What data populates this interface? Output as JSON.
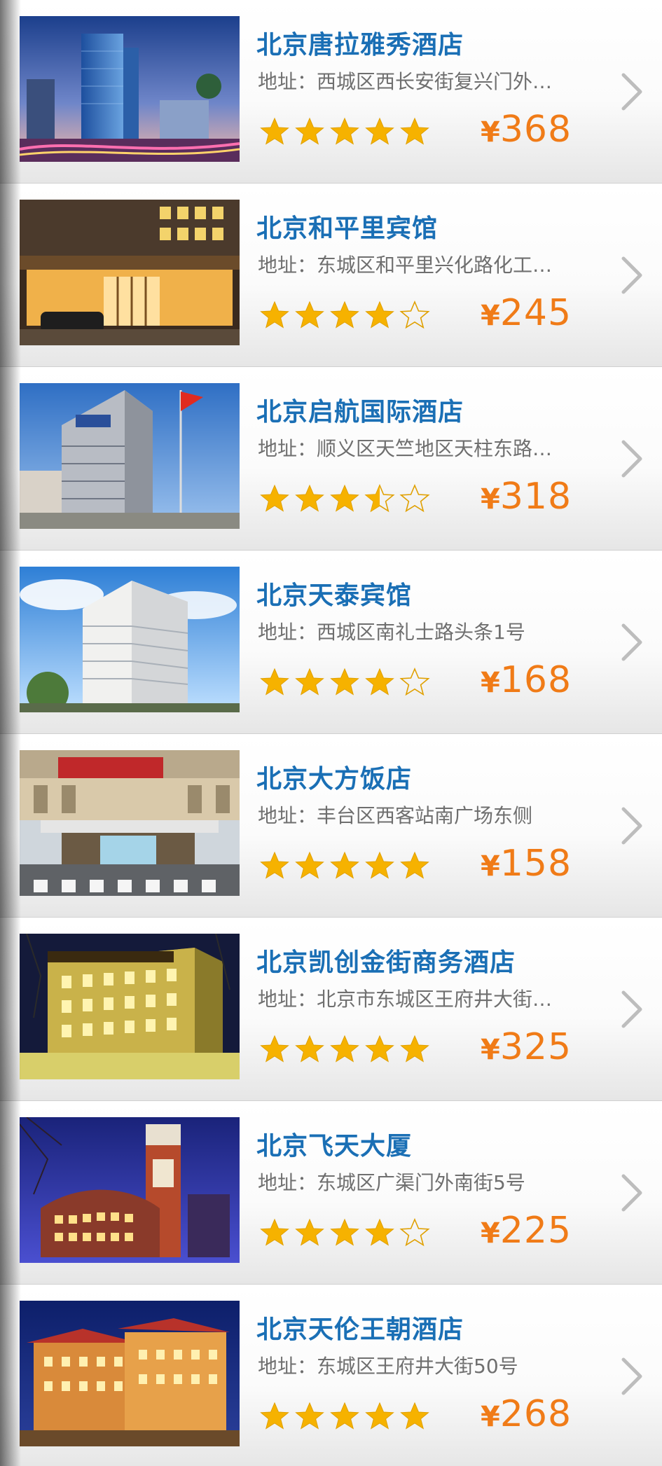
{
  "colors": {
    "hotel_name": "#1a6fb5",
    "address": "#6f6f6f",
    "price": "#f07b17",
    "star_fill": "#f6b200",
    "star_outline": "#e0a000"
  },
  "icons": {
    "chevron": "chevron-right-icon",
    "star_full": "star-full-icon",
    "star_half": "star-half-icon",
    "star_empty": "star-empty-icon"
  },
  "hotels": [
    {
      "name": "北京唐拉雅秀酒店",
      "address": "地址：西城区西长安街复兴门外…",
      "rating": 5,
      "currency": "¥",
      "price": "368",
      "photo": "photo-glass-tower-night"
    },
    {
      "name": "北京和平里宾馆",
      "address": "地址：东城区和平里兴化路化工…",
      "rating": 4,
      "currency": "¥",
      "price": "245",
      "photo": "photo-lit-entrance-evening"
    },
    {
      "name": "北京启航国际酒店",
      "address": "地址：顺义区天竺地区天柱东路…",
      "rating": 3.5,
      "currency": "¥",
      "price": "318",
      "photo": "photo-grey-building-flag"
    },
    {
      "name": "北京天泰宾馆",
      "address": "地址：西城区南礼士路头条1号",
      "rating": 4,
      "currency": "¥",
      "price": "168",
      "photo": "photo-white-tower-sky"
    },
    {
      "name": "北京大方饭店",
      "address": "地址：丰台区西客站南广场东侧",
      "rating": 5,
      "currency": "¥",
      "price": "158",
      "photo": "photo-hotel-portico"
    },
    {
      "name": "北京凯创金街商务酒店",
      "address": "地址：北京市东城区王府井大街…",
      "rating": 5,
      "currency": "¥",
      "price": "325",
      "photo": "photo-gold-lit-building-night"
    },
    {
      "name": "北京飞天大厦",
      "address": "地址：东城区广渠门外南街5号",
      "rating": 4,
      "currency": "¥",
      "price": "225",
      "photo": "photo-tower-blue-dusk"
    },
    {
      "name": "北京天伦王朝酒店",
      "address": "地址：东城区王府井大街50号",
      "rating": 5,
      "currency": "¥",
      "price": "268",
      "photo": "photo-palace-style-night"
    }
  ]
}
